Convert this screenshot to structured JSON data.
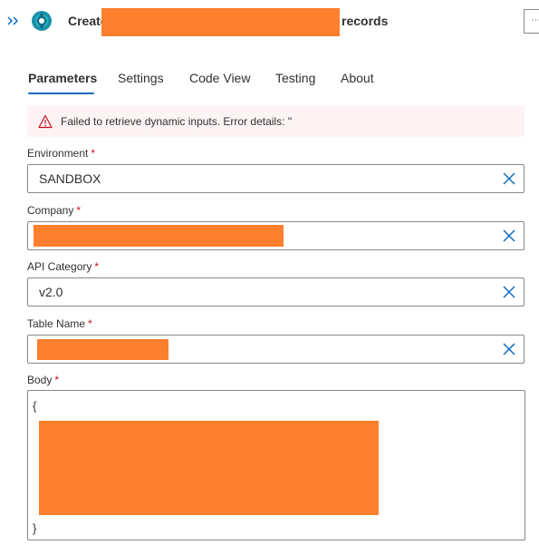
{
  "header": {
    "title_prefix": "Create",
    "title_suffix": "records",
    "more_label": "···"
  },
  "tabs": [
    {
      "label": "Parameters",
      "active": true
    },
    {
      "label": "Settings",
      "active": false
    },
    {
      "label": "Code View",
      "active": false
    },
    {
      "label": "Testing",
      "active": false
    },
    {
      "label": "About",
      "active": false
    }
  ],
  "error": {
    "message": "Failed to retrieve dynamic inputs. Error details: ''"
  },
  "fields": {
    "environment": {
      "label": "Environment",
      "required_mark": "*",
      "value": "SANDBOX"
    },
    "company": {
      "label": "Company",
      "required_mark": "*",
      "value": ""
    },
    "api_category": {
      "label": "API Category",
      "required_mark": "*",
      "value": "v2.0"
    },
    "table_name": {
      "label": "Table Name",
      "required_mark": "*",
      "value": ""
    },
    "body": {
      "label": "Body",
      "required_mark": "*",
      "open_brace": "{",
      "close_brace": "}"
    }
  },
  "icons": {
    "expand": "chevrons-right-icon",
    "app": "app-logo-icon",
    "warning": "warning-triangle-icon",
    "clear": "close-icon"
  },
  "colors": {
    "accent": "#0f6cbd",
    "error_bg": "#fdf3f4",
    "error_icon": "#c50f1f",
    "required": "#c50f1f",
    "redaction": "#fe7f2d"
  }
}
